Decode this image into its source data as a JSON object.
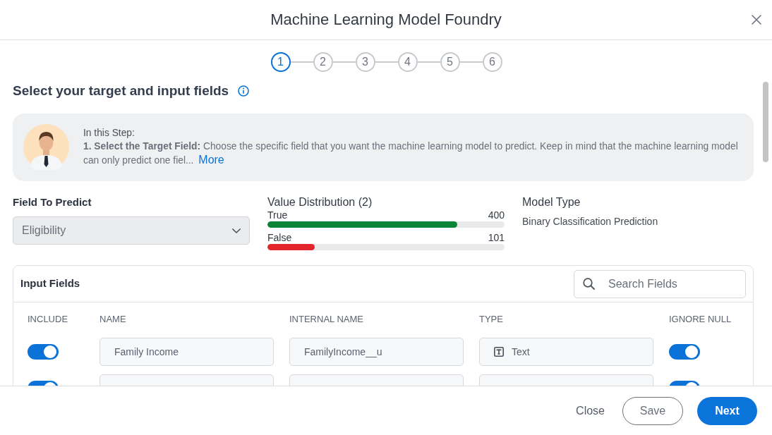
{
  "window": {
    "title": "Machine Learning Model Foundry"
  },
  "steps": [
    {
      "label": "1",
      "selected": true
    },
    {
      "label": "2",
      "selected": false
    },
    {
      "label": "3",
      "selected": false
    },
    {
      "label": "4",
      "selected": false
    },
    {
      "label": "5",
      "selected": false
    },
    {
      "label": "6",
      "selected": false
    }
  ],
  "section": {
    "title": "Select your target and input fields"
  },
  "guide": {
    "heading": "In this Step:",
    "text": "**1. Select the Target Field:** Choose the specific field that you want the machine learning model to predict. Keep in mind that the machine learning model can only predict one fiel...",
    "link": "More"
  },
  "target": {
    "label": "Field To Predict",
    "value": "Eligibility",
    "disabled": true
  },
  "distribution": {
    "title": "Value Distribution (2)",
    "values": [
      {
        "label": "True",
        "count": "400",
        "level": 0.8,
        "color": "#0a8537"
      },
      {
        "label": "False",
        "count": "101",
        "level": 0.2,
        "color": "#e3262b"
      }
    ]
  },
  "model_type": {
    "label": "Model Type",
    "value": "Binary Classification Prediction"
  },
  "input_fields": {
    "title": "Input Fields",
    "search": {
      "placeholder": "Search Fields"
    },
    "columns": [
      "INCLUDE",
      "NAME",
      "INTERNAL NAME",
      "TYPE",
      "IGNORE NULL"
    ],
    "rows": [
      {
        "include": true,
        "name": "Family Income",
        "internal_name": "FamilyIncome__u",
        "type": "Text",
        "ignore_null": true
      },
      {
        "include": true,
        "ignore_null": true
      }
    ]
  },
  "footer": {
    "buttons": [
      {
        "label": "Close",
        "kind": "text"
      },
      {
        "label": "Save",
        "kind": "outline"
      },
      {
        "label": "Next",
        "kind": "primary"
      }
    ]
  }
}
